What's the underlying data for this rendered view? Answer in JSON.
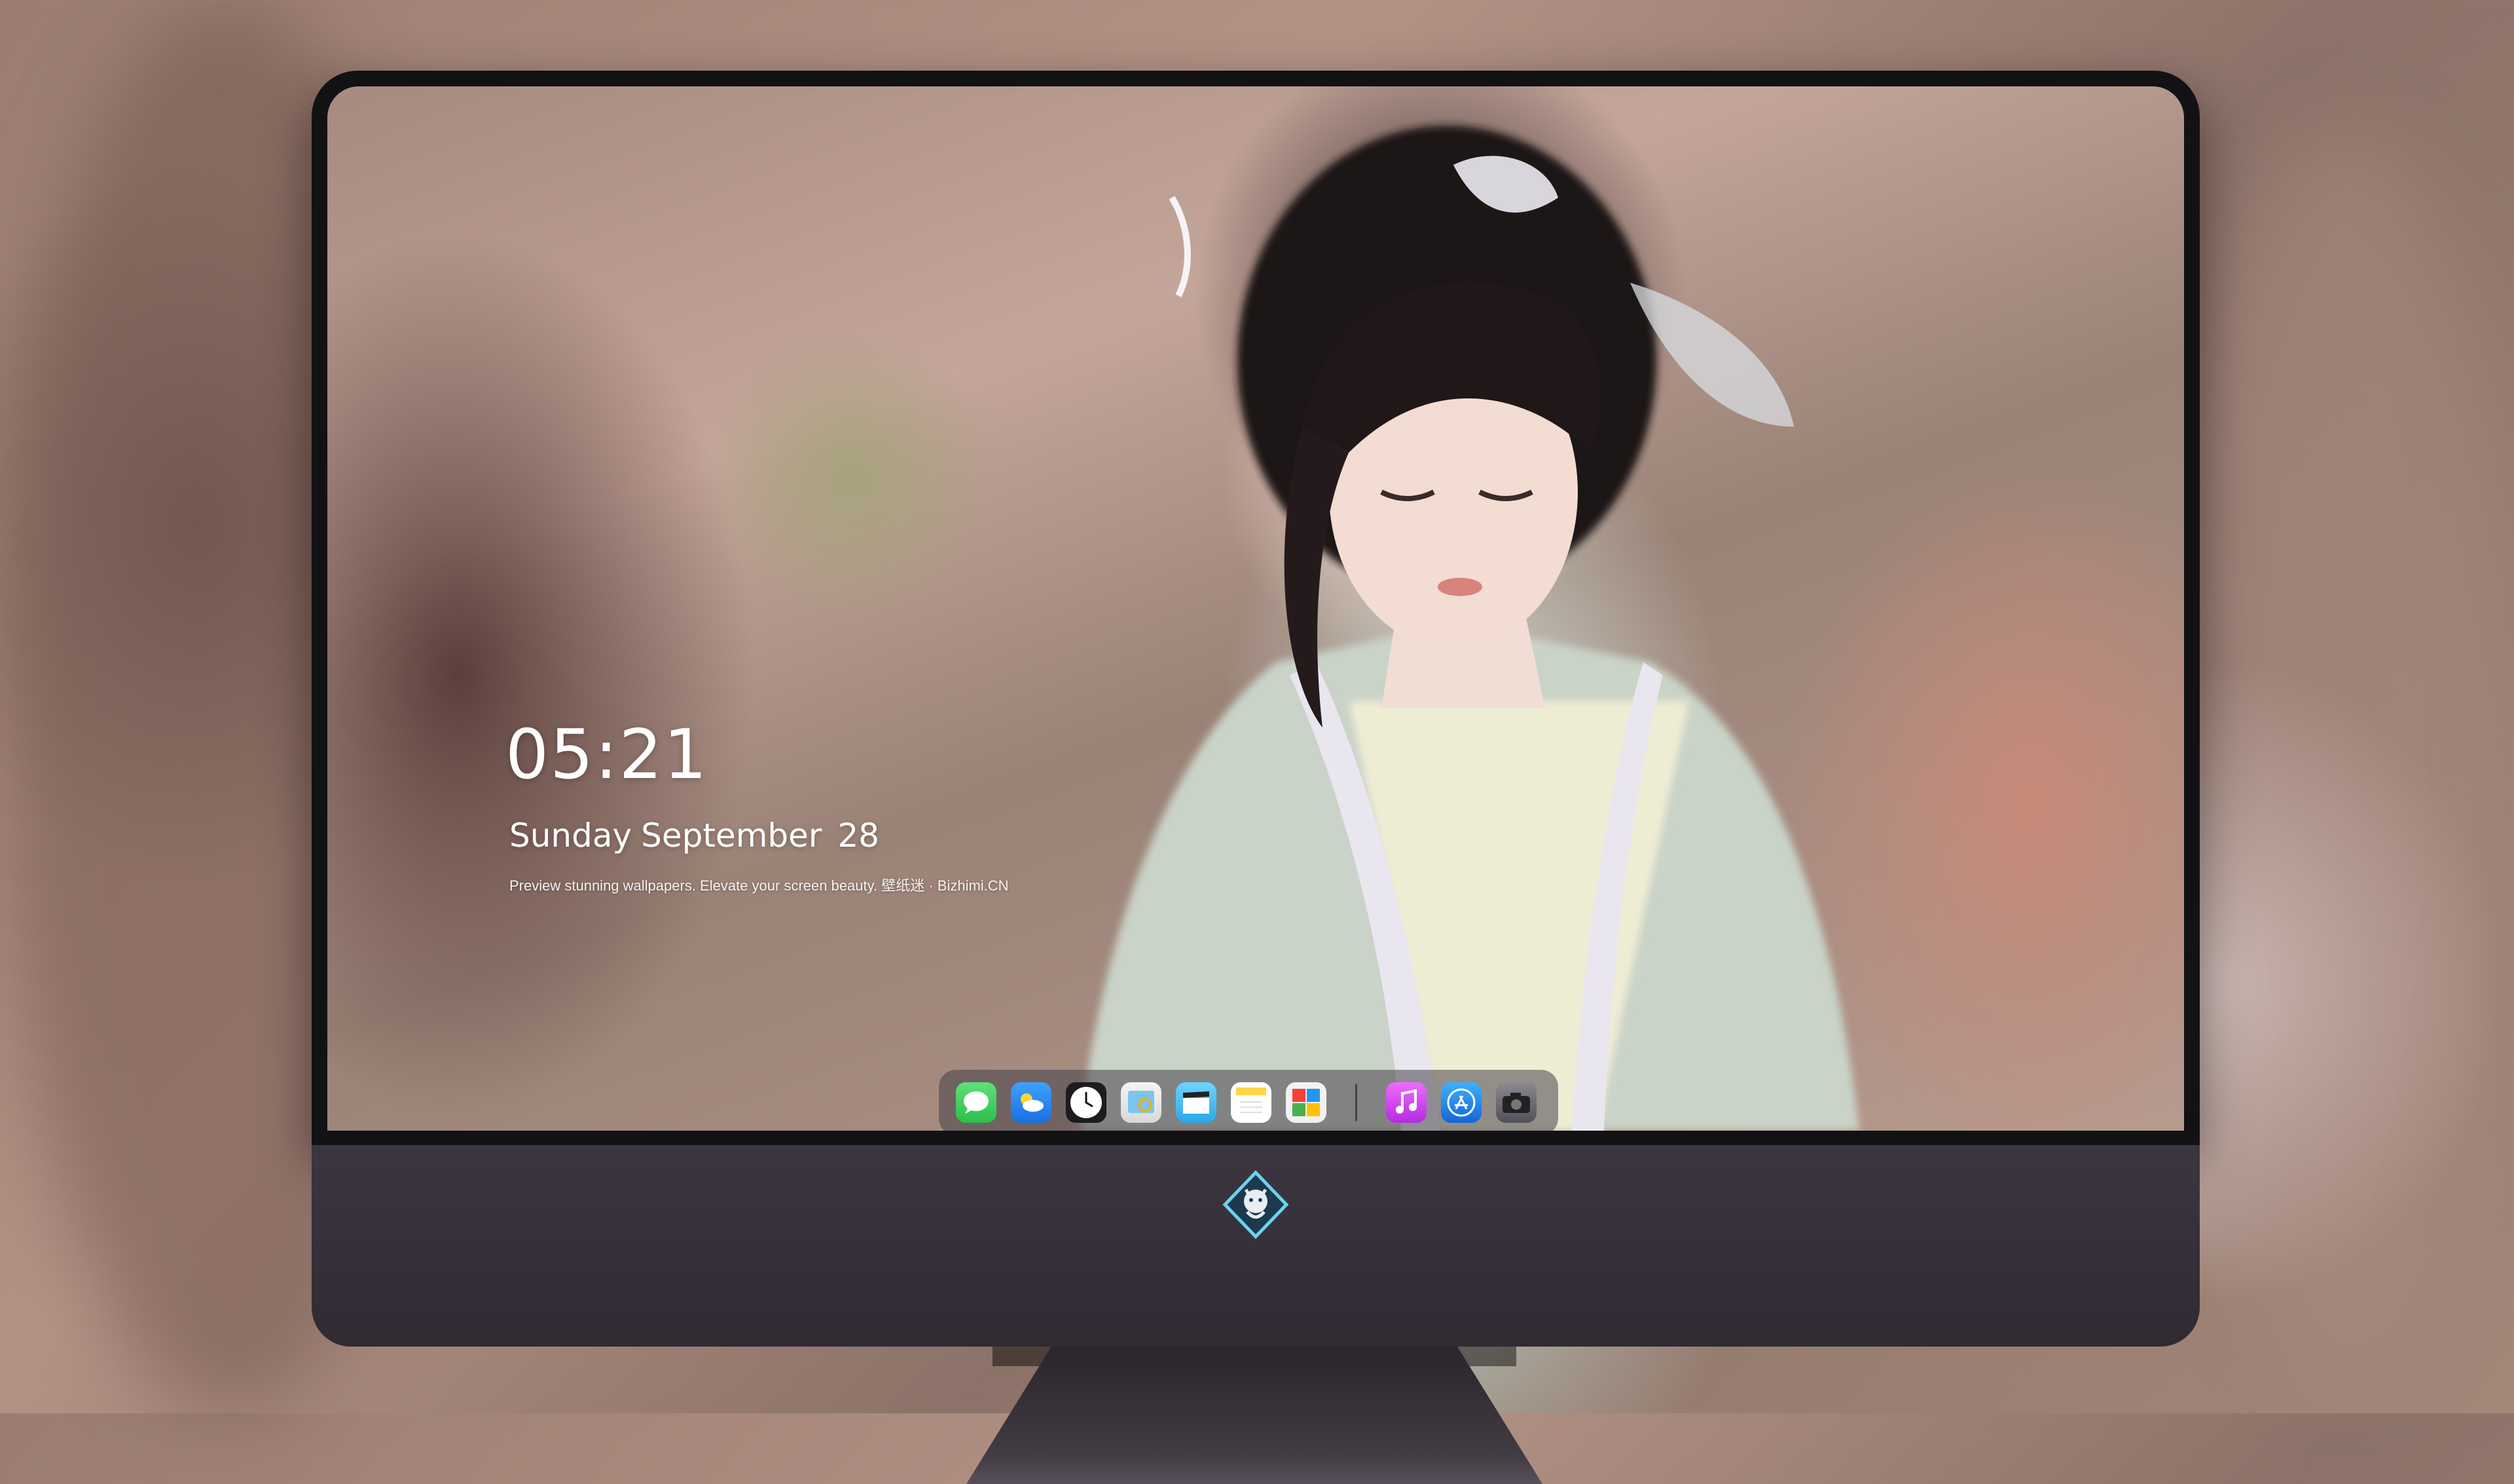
{
  "lockscreen": {
    "time": "05:21",
    "weekday": "Sunday",
    "month": "September",
    "day": "28",
    "tagline": "Preview stunning wallpapers. Elevate your screen beauty. 壁纸迷 · Bizhimi.CN"
  },
  "dock": {
    "apps": [
      {
        "name": "Messages",
        "icon": "messages-icon",
        "color": "#34c759"
      },
      {
        "name": "Weather",
        "icon": "weather-icon",
        "color": "#2f8fff"
      },
      {
        "name": "Clock",
        "icon": "clock-icon",
        "color": "#1c1c1e"
      },
      {
        "name": "Preview",
        "icon": "preview-icon",
        "color": "#e8c540"
      },
      {
        "name": "Clips",
        "icon": "clips-icon",
        "color": "#4fc3f7"
      },
      {
        "name": "Notes",
        "icon": "notes-icon",
        "color": "#ffd54a"
      },
      {
        "name": "Photo Booth",
        "icon": "photo-booth-icon",
        "color": "#4caf50"
      },
      {
        "name": "Music",
        "icon": "music-icon",
        "color": "#e040fb"
      },
      {
        "name": "App Store",
        "icon": "app-store-icon",
        "color": "#1e88e5"
      },
      {
        "name": "Camera",
        "icon": "camera-icon",
        "color": "#6d6d72"
      }
    ]
  },
  "device": {
    "logo": "dragon-badge-icon"
  }
}
